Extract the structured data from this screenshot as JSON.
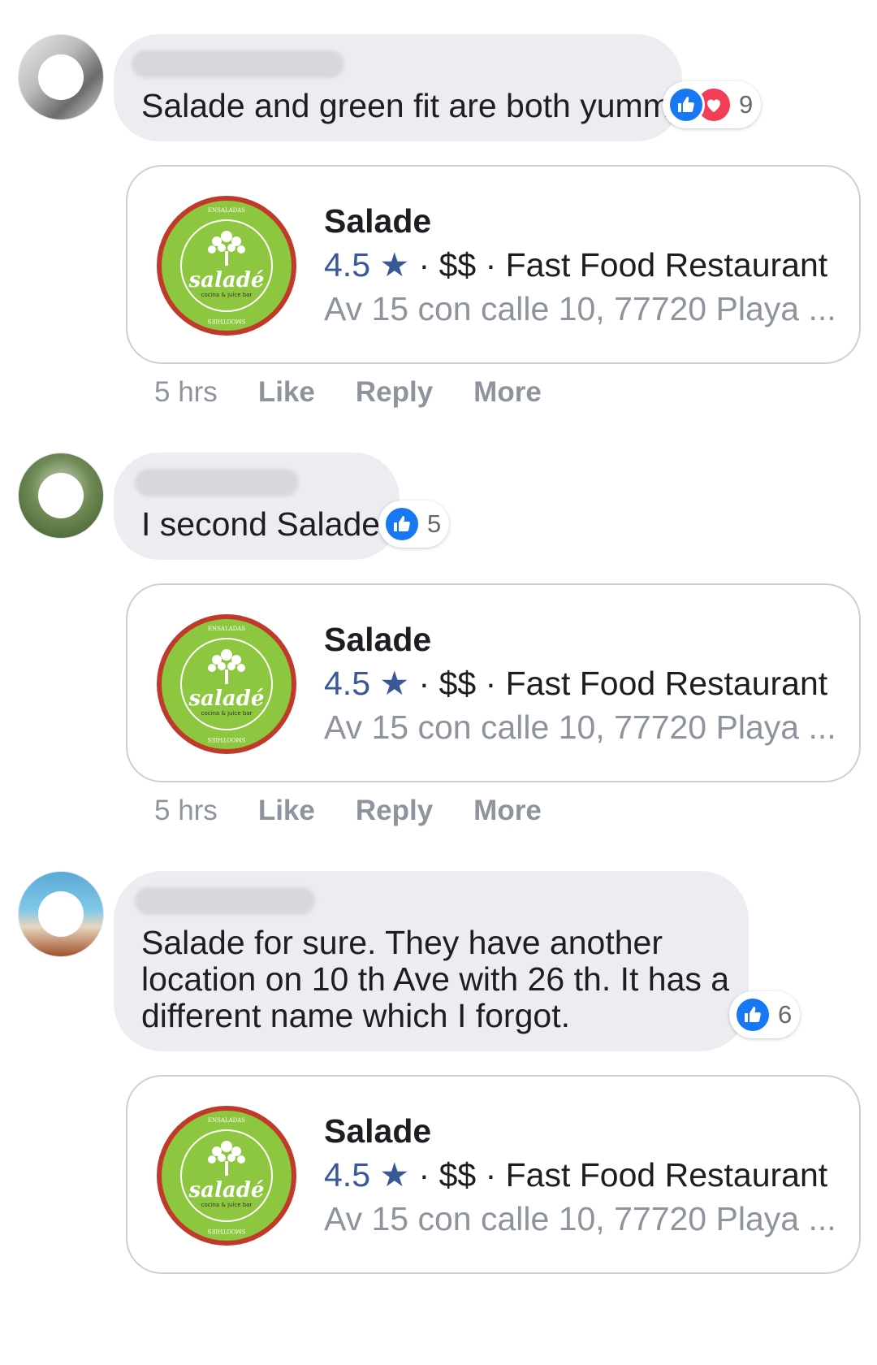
{
  "comments": [
    {
      "text": "Salade and green fit are both yummy",
      "reaction_count": "9",
      "reactions": [
        "like-icon",
        "love-icon"
      ],
      "time": "5 hrs",
      "actions": [
        "Like",
        "Reply",
        "More"
      ],
      "place": {
        "name": "Salade",
        "rating": "4.5 ★",
        "price_category": " · $$ · Fast Food Restaurant",
        "address": "Av 15 con calle 10, 77720 Playa ..."
      }
    },
    {
      "text": "I second Salade!",
      "reaction_count": "5",
      "reactions": [
        "like-icon"
      ],
      "time": "5 hrs",
      "actions": [
        "Like",
        "Reply",
        "More"
      ],
      "place": {
        "name": "Salade",
        "rating": "4.5 ★",
        "price_category": " · $$ · Fast Food Restaurant",
        "address": "Av 15 con calle 10, 77720 Playa ..."
      }
    },
    {
      "text_lines": [
        "Salade for sure. They have another",
        "location on 10 th Ave with 26 th. It has a",
        "different name which I forgot."
      ],
      "reaction_count": "6",
      "reactions": [
        "like-icon"
      ],
      "place": {
        "name": "Salade",
        "rating": "4.5 ★",
        "price_category": " · $$ · Fast Food Restaurant",
        "address": "Av 15 con calle 10, 77720 Playa ..."
      }
    }
  ],
  "logo": {
    "wordmark": "saladé",
    "tagline": "cocina & juice bar",
    "ring_words": [
      "ENSALADAS",
      "BAGELS",
      "PANINIS",
      "SMOOTHIES",
      "JUGOS",
      "WRAPS"
    ]
  },
  "colors": {
    "bubble": "#ebedf0",
    "like_blue": "#1877f2",
    "love_red": "#f33e58",
    "rating_blue": "#385898",
    "logo_green": "#8dc63f"
  }
}
